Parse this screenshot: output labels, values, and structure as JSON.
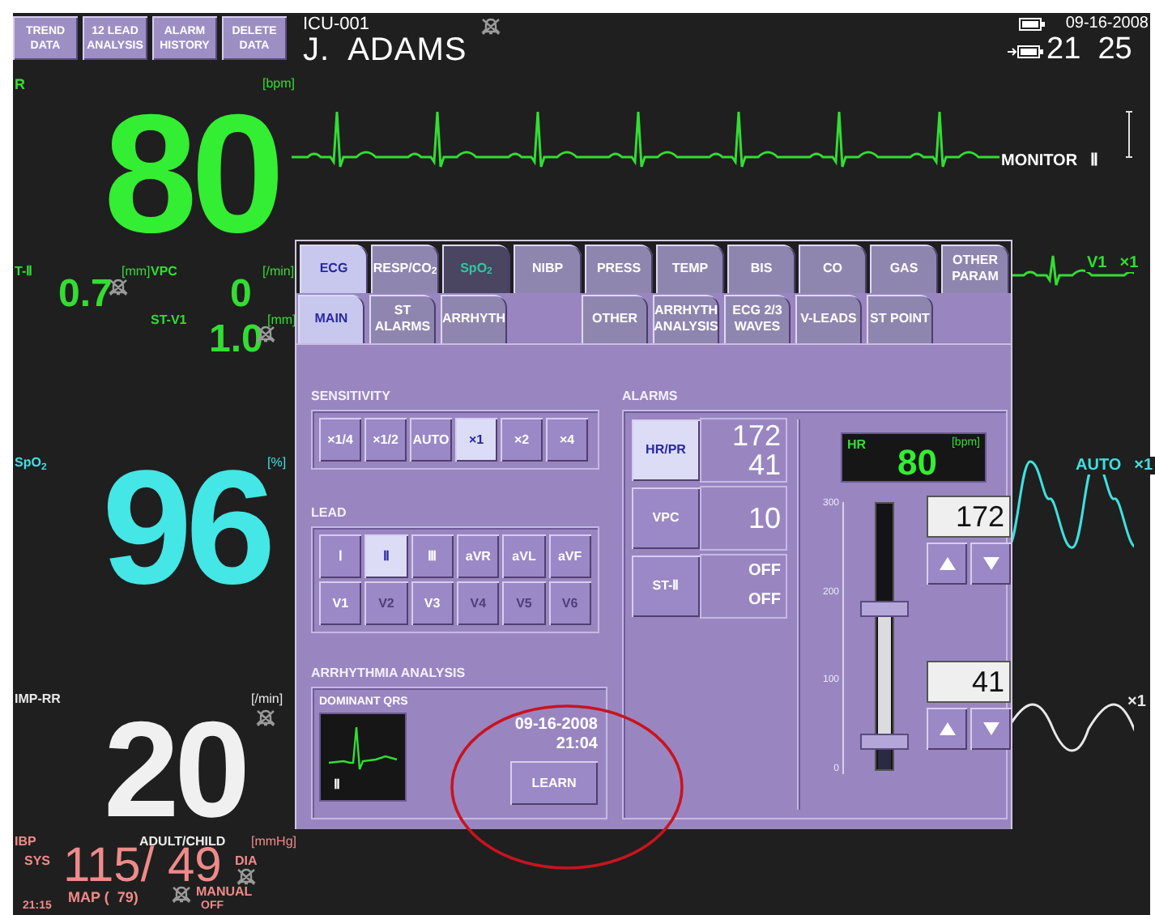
{
  "top_buttons": [
    {
      "lines": [
        "TREND",
        "DATA"
      ]
    },
    {
      "lines": [
        "12 LEAD",
        "ANALYSIS"
      ]
    },
    {
      "lines": [
        "ALARM",
        "HISTORY"
      ]
    },
    {
      "lines": [
        "DELETE",
        "DATA"
      ]
    }
  ],
  "patient": {
    "bed": "ICU-001",
    "name": "J.  ADAMS",
    "alarm_off": true
  },
  "clock": {
    "date": "09-16-2008",
    "time": "21  25"
  },
  "hr": {
    "label": "R",
    "unit": "[bpm]",
    "value": "80"
  },
  "st": {
    "label": "T-Ⅱ",
    "unit": "[mm]",
    "value": "0.7",
    "alarm_off": true,
    "vpc_label": "VPC",
    "vpc_unit": "[/min]",
    "vpc_value": "0",
    "st2_label": "ST-V1",
    "st2_unit": "[mm]",
    "st2_value": "1.0",
    "st2_alarm_off": true
  },
  "spo2": {
    "label": "SpO$_{2}$",
    "unit": "[%]",
    "value": "96"
  },
  "rr": {
    "label": "IMP-RR",
    "unit": "[/min]",
    "value": "20",
    "alarm_off": true
  },
  "ibp": {
    "label": "IBP",
    "mode": "ADULT/CHILD",
    "unit": "[mmHg]",
    "sys_label": "SYS",
    "value": "115/ 49",
    "dia_label": "DIA",
    "dia_alarm_off": true,
    "map": "MAP (  79)",
    "map_alarm_off": true,
    "manual": "MANUAL",
    "time": "21:15",
    "off": "OFF"
  },
  "waves": [
    {
      "kind": "ecg",
      "color": "#33dd33",
      "labels": [
        "MONITOR",
        "Ⅱ"
      ]
    },
    {
      "kind": "ecg2",
      "color": "#33dd33",
      "labels": [
        "V1",
        "×1"
      ]
    },
    {
      "kind": "pleth",
      "color": "#40e0e0",
      "labels": [
        "AUTO",
        "×1"
      ]
    },
    {
      "kind": "resp",
      "color": "#e8e8e8",
      "labels": [
        "×1"
      ]
    }
  ],
  "dialog": {
    "tabs": [
      {
        "label": "ECG",
        "selected": true,
        "highlighted": false
      },
      {
        "label": "RESP/CO$_{2}$",
        "selected": false,
        "highlighted": false
      },
      {
        "label": "SpO$_{2}$",
        "selected": false,
        "highlighted": true
      },
      {
        "label": "NIBP",
        "selected": false,
        "highlighted": false
      },
      {
        "label": "PRESS",
        "selected": false,
        "highlighted": false
      },
      {
        "label": "TEMP",
        "selected": false,
        "highlighted": false
      },
      {
        "label": "BIS",
        "selected": false,
        "highlighted": false
      },
      {
        "label": "CO",
        "selected": false,
        "highlighted": false
      },
      {
        "label": "GAS",
        "selected": false,
        "highlighted": false
      },
      {
        "label": "OTHER PARAM",
        "selected": false,
        "highlighted": false
      }
    ],
    "subtab_groups": [
      [
        {
          "label": "MAIN",
          "selected": true
        },
        {
          "label": "ST ALARMS",
          "selected": false
        },
        {
          "label": "ARRHYTH",
          "selected": false
        }
      ],
      [
        {
          "label": "OTHER",
          "selected": false
        },
        {
          "label": "ARRHYTH ANALYSIS",
          "selected": false
        },
        {
          "label": "ECG 2/3 WAVES",
          "selected": false
        },
        {
          "label": "V-LEADS",
          "selected": false
        },
        {
          "label": "ST POINT",
          "selected": false
        }
      ]
    ],
    "sensitivity": {
      "label": "SENSITIVITY",
      "options": [
        {
          "label": "×1/4",
          "selected": false
        },
        {
          "label": "×1/2",
          "selected": false
        },
        {
          "label": "AUTO",
          "selected": false
        },
        {
          "label": "×1",
          "selected": true
        },
        {
          "label": "×2",
          "selected": false
        },
        {
          "label": "×4",
          "selected": false
        }
      ]
    },
    "lead": {
      "label": "LEAD",
      "options": [
        {
          "label": "Ⅰ",
          "selected": false,
          "disabled": false
        },
        {
          "label": "Ⅱ",
          "selected": true,
          "disabled": false
        },
        {
          "label": "Ⅲ",
          "selected": false,
          "disabled": false
        },
        {
          "label": "aVR",
          "selected": false,
          "disabled": false
        },
        {
          "label": "aVL",
          "selected": false,
          "disabled": false
        },
        {
          "label": "aVF",
          "selected": false,
          "disabled": false
        },
        {
          "label": "V1",
          "selected": false,
          "disabled": false
        },
        {
          "label": "V2",
          "selected": false,
          "disabled": true
        },
        {
          "label": "V3",
          "selected": false,
          "disabled": false
        },
        {
          "label": "V4",
          "selected": false,
          "disabled": true
        },
        {
          "label": "V5",
          "selected": false,
          "disabled": true
        },
        {
          "label": "V6",
          "selected": false,
          "disabled": true
        }
      ]
    },
    "arrhythmia": {
      "label": "ARRHYTHMIA ANALYSIS",
      "dominant_label": "DOMINANT QRS",
      "lead": "Ⅱ",
      "date": "09-16-2008",
      "time": "21:04",
      "button": "LEARN"
    },
    "alarms": {
      "label": "ALARMS",
      "rows": [
        {
          "label": "HR/PR",
          "selected": true,
          "values": [
            "172",
            "41"
          ]
        },
        {
          "label": "VPC",
          "selected": false,
          "values": [
            "10"
          ]
        },
        {
          "label": "ST-Ⅱ",
          "selected": false,
          "values": [
            "OFF",
            "OFF"
          ]
        }
      ],
      "display": {
        "label": "HR",
        "unit": "[bpm]",
        "value": "80"
      },
      "scale": [
        "300",
        "200",
        "100",
        "0"
      ],
      "upper": {
        "value": "172",
        "level": 0.6
      },
      "lower": {
        "value": "41",
        "level": 0.11
      }
    }
  },
  "annotation_ellipse": true
}
